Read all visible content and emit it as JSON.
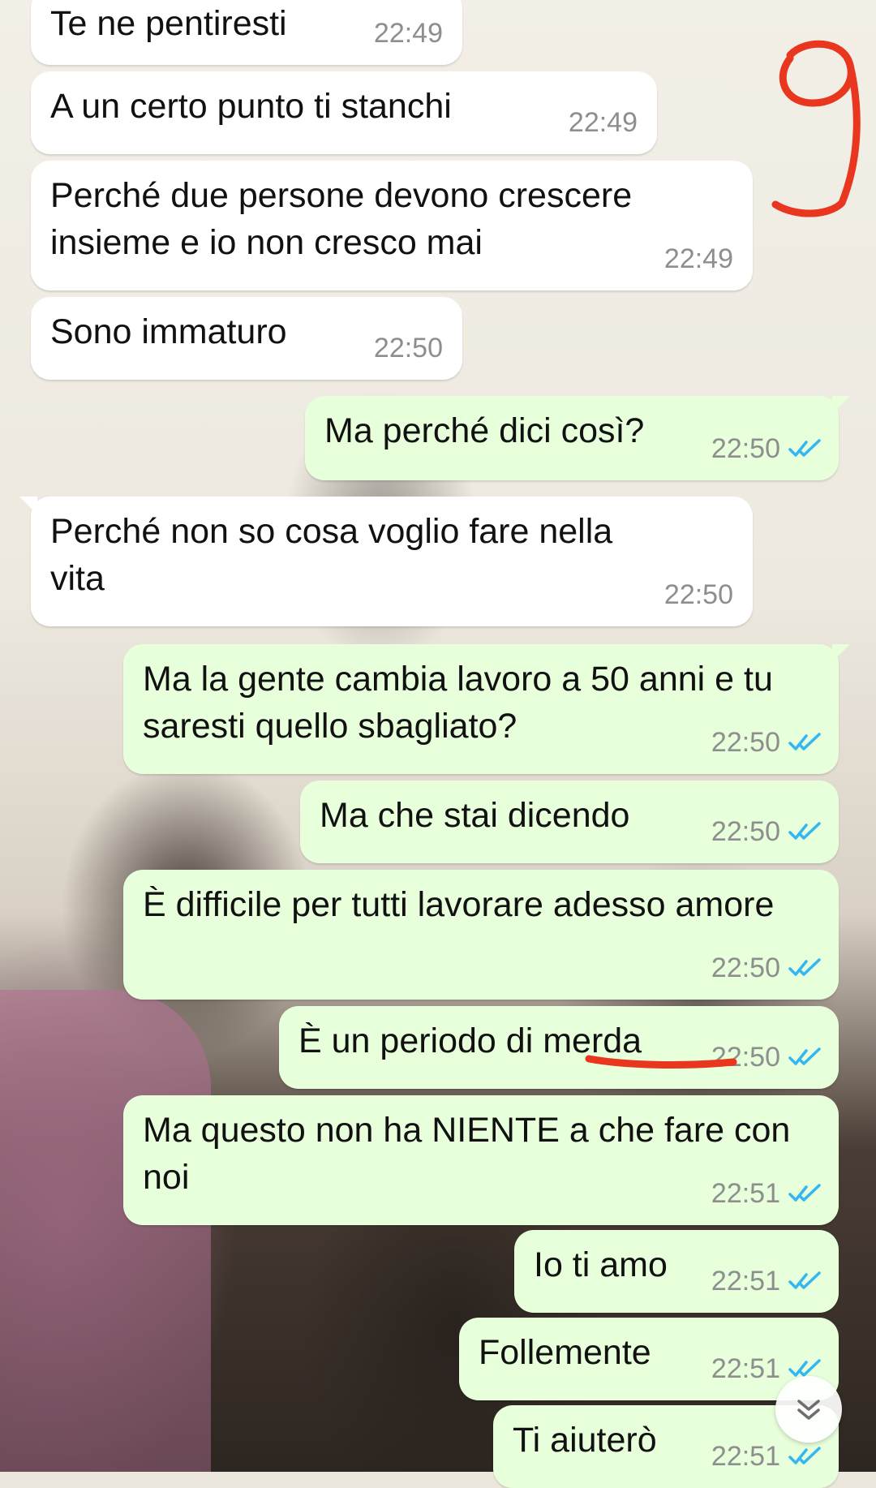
{
  "messages": [
    {
      "text": "Te ne pentiresti",
      "time": "22:49",
      "direction": "incoming"
    },
    {
      "text": "A un certo punto ti stanchi",
      "time": "22:49",
      "direction": "incoming"
    },
    {
      "text": "Perché due persone devono crescere insieme e io non cresco mai",
      "time": "22:49",
      "direction": "incoming"
    },
    {
      "text": "Sono immaturo",
      "time": "22:50",
      "direction": "incoming"
    },
    {
      "text": "Ma perché dici così?",
      "time": "22:50",
      "direction": "outgoing",
      "status": "read"
    },
    {
      "text": "Perché non so cosa voglio fare nella vita",
      "time": "22:50",
      "direction": "incoming"
    },
    {
      "text": "Ma la gente cambia lavoro a 50 anni e tu saresti quello sbagliato?",
      "time": "22:50",
      "direction": "outgoing",
      "status": "read"
    },
    {
      "text": "Ma che stai dicendo",
      "time": "22:50",
      "direction": "outgoing",
      "status": "read"
    },
    {
      "text": "È difficile per tutti lavorare adesso amore",
      "time": "22:50",
      "direction": "outgoing",
      "status": "read"
    },
    {
      "text": "È un periodo di merda",
      "time": "22:50",
      "direction": "outgoing",
      "status": "read"
    },
    {
      "text": "Ma questo non ha NIENTE a che fare con noi",
      "time": "22:51",
      "direction": "outgoing",
      "status": "read"
    },
    {
      "text": "Io ti amo",
      "time": "22:51",
      "direction": "outgoing",
      "status": "read"
    },
    {
      "text": "Follemente",
      "time": "22:51",
      "direction": "outgoing",
      "status": "read"
    },
    {
      "text": "Ti aiuterò",
      "time": "22:51",
      "direction": "outgoing",
      "status": "read"
    }
  ],
  "colors": {
    "incoming_bubble": "#ffffff",
    "outgoing_bubble": "#e7ffdb",
    "read_ticks": "#34b7f1",
    "annotation": "#e8361f"
  },
  "icons": {
    "read_receipt": "double-check-icon",
    "scroll_down": "chevron-double-down-icon"
  }
}
